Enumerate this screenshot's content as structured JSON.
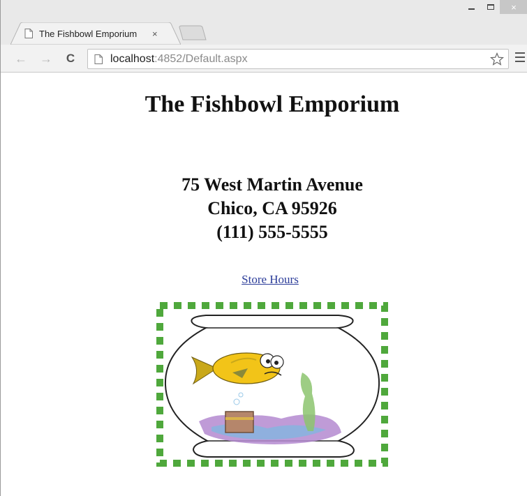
{
  "browser": {
    "tab_title": "The Fishbowl Emporium",
    "tab_close": "×",
    "url_host": "localhost",
    "url_rest": ":4852/Default.aspx",
    "window_controls": {
      "close": "×"
    }
  },
  "page": {
    "title": "The Fishbowl Emporium",
    "address_line1": "75 West Martin Avenue",
    "address_line2": "Chico, CA 95926",
    "phone": "(111) 555-5555",
    "hours_link": "Store Hours",
    "image": "fishbowl-illustration"
  },
  "colors": {
    "border_green": "#4fa83c",
    "fish_yellow": "#f2c418",
    "link_blue": "#2b3c99"
  }
}
